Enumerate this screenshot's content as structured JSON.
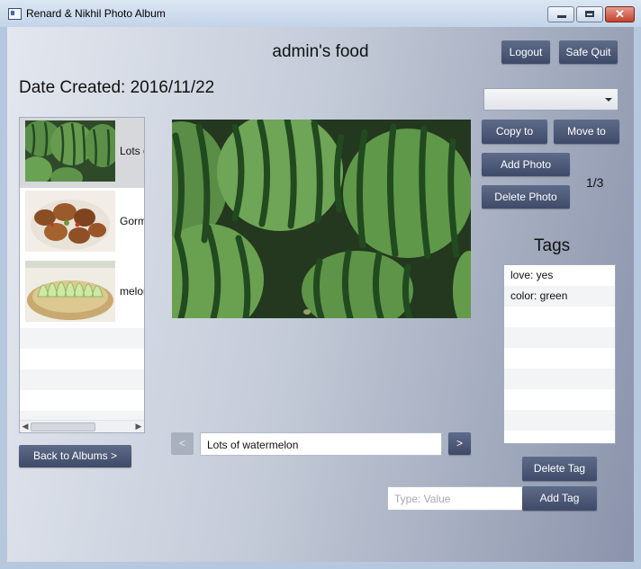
{
  "window": {
    "title": "Renard & Nikhil Photo Album"
  },
  "header": {
    "album_title": "admin's food",
    "logout_label": "Logout",
    "safe_quit_label": "Safe Quit"
  },
  "album": {
    "date_created": "Date Created: 2016/11/22"
  },
  "photos": [
    {
      "caption": "Lots of watermelon",
      "thumbnail": "watermelon"
    },
    {
      "caption": "Gorm",
      "thumbnail": "dumplings"
    },
    {
      "caption": "melon",
      "thumbnail": "melon-slices"
    }
  ],
  "photo_list": {
    "selected_index": 0
  },
  "actions": {
    "back_to_albums_label": "Back to Albums >",
    "copy_to_label": "Copy to",
    "move_to_label": "Move to",
    "add_photo_label": "Add Photo",
    "delete_photo_label": "Delete Photo",
    "album_select_value": ""
  },
  "viewer": {
    "caption": "Lots of watermelon",
    "prev_label": "<",
    "next_label": ">",
    "counter": "1/3"
  },
  "tags": {
    "heading": "Tags",
    "items": [
      {
        "label": "love: yes"
      },
      {
        "label": "color: green"
      }
    ],
    "delete_label": "Delete Tag",
    "add_label": "Add Tag",
    "input_placeholder": "Type: Value",
    "input_value": ""
  },
  "colors": {
    "button": "#4a5677",
    "accent_green": "#3f7a3a"
  }
}
